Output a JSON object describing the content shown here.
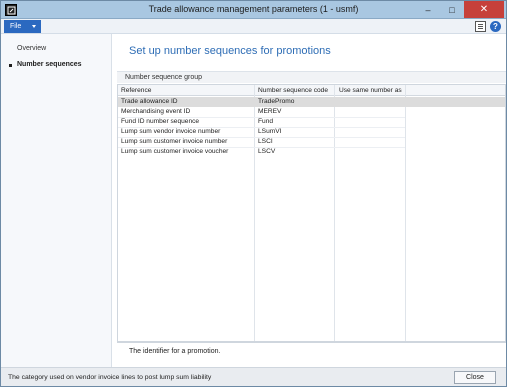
{
  "window": {
    "title": "Trade allowance management parameters (1 - usmf)",
    "minimize_glyph": "–",
    "maximize_glyph": "□",
    "close_glyph": "✕"
  },
  "menubar": {
    "file_label": "File",
    "help_glyph": "?"
  },
  "nav": {
    "items": [
      {
        "label": "Overview",
        "active": false
      },
      {
        "label": "Number sequences",
        "active": true
      }
    ]
  },
  "main": {
    "title": "Set up number sequences for promotions",
    "group_label": "Number sequence group",
    "grid": {
      "columns": [
        "Reference",
        "Number sequence code",
        "Use same number as"
      ],
      "rows": [
        {
          "reference": "Trade allowance ID",
          "code": "TradePromo",
          "same_as": "",
          "selected": true
        },
        {
          "reference": "Merchandising event ID",
          "code": "MEREV",
          "same_as": ""
        },
        {
          "reference": "Fund ID number sequence",
          "code": "Fund",
          "same_as": ""
        },
        {
          "reference": "Lump sum vendor invoice number",
          "code": "LSumVI",
          "same_as": ""
        },
        {
          "reference": "Lump sum customer invoice number",
          "code": "LSCI",
          "same_as": ""
        },
        {
          "reference": "Lump sum customer invoice voucher",
          "code": "LSCV",
          "same_as": ""
        }
      ]
    },
    "help_text": "The identifier for a promotion."
  },
  "statusbar": {
    "text": "The category used on vendor invoice lines to post lump sum liability",
    "close_label": "Close"
  },
  "colors": {
    "title_bar": "#a9c7e1",
    "file_button": "#2b69c0",
    "page_title": "#2e6db5",
    "close_red": "#c6403a"
  }
}
